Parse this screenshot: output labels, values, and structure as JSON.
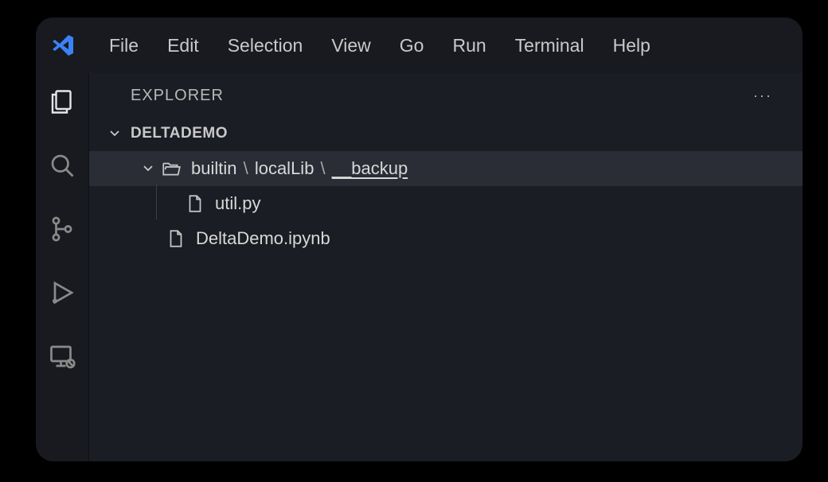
{
  "menubar": {
    "items": [
      "File",
      "Edit",
      "Selection",
      "View",
      "Go",
      "Run",
      "Terminal",
      "Help"
    ]
  },
  "activitybar": {
    "items": [
      {
        "name": "explorer",
        "active": true
      },
      {
        "name": "search",
        "active": false
      },
      {
        "name": "source-control",
        "active": false
      },
      {
        "name": "run-debug",
        "active": false
      },
      {
        "name": "remote",
        "active": false
      }
    ]
  },
  "sidebar": {
    "title": "EXPLORER",
    "workspace": "DELTADEMO",
    "tree": {
      "folder": {
        "segments": [
          "builtin",
          "localLib",
          "__backup"
        ],
        "separator": "\\",
        "expanded": true,
        "children": [
          {
            "name": "util.py",
            "kind": "file",
            "depth": 2
          }
        ]
      },
      "siblings": [
        {
          "name": "DeltaDemo.ipynb",
          "kind": "file",
          "depth": 1
        }
      ]
    }
  }
}
